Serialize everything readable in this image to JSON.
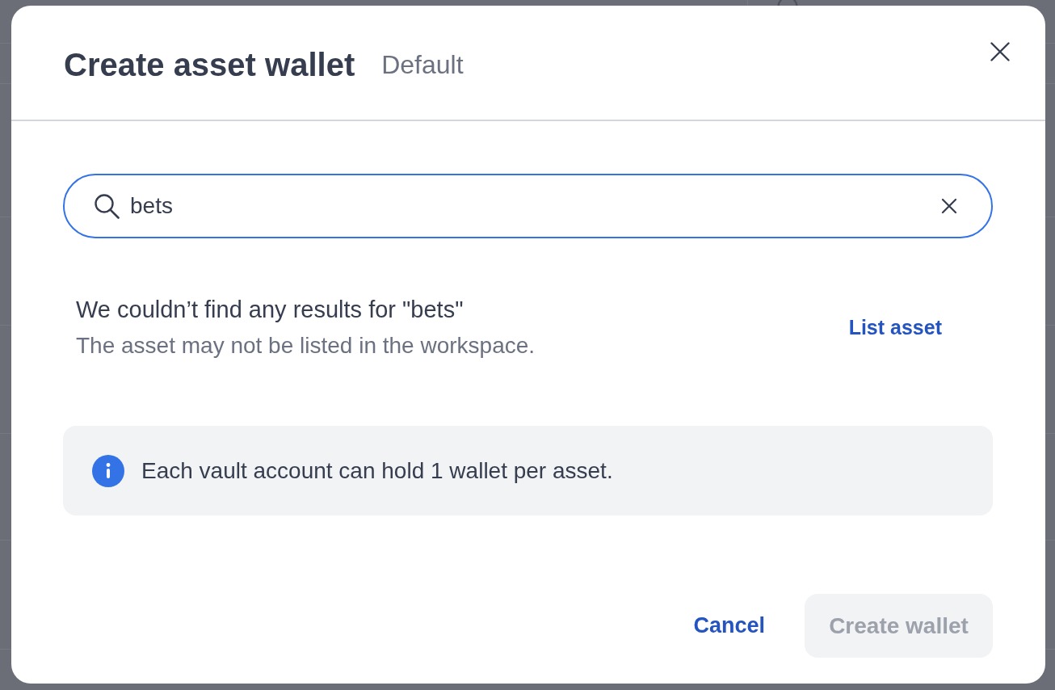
{
  "dialog": {
    "title": "Create asset wallet",
    "subtitle": "Default"
  },
  "search": {
    "value": "bets",
    "focused": true
  },
  "empty_state": {
    "message": "We couldn’t find any results for \"bets\"",
    "hint": "The asset may not be listed in the workspace.",
    "action": "List asset"
  },
  "info_banner": {
    "text": "Each vault account can hold 1 wallet per asset."
  },
  "buttons": [
    {
      "label": "Cancel",
      "kind": "link",
      "disabled": false
    },
    {
      "label": "Create wallet",
      "kind": "primary",
      "disabled": true
    }
  ]
}
